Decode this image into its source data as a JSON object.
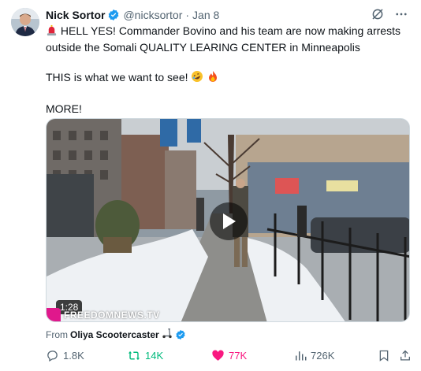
{
  "author": {
    "name": "Nick Sortor",
    "handle": "@nicksortor",
    "separator": "·",
    "date": "Jan 8"
  },
  "tweet": {
    "line1": "HELL YES! Commander Bovino and his team are now making arrests outside the Somali QUALITY LEARING CENTER in Minneapolis",
    "line2": "THIS is what we want to see!",
    "line3": "MORE!"
  },
  "media": {
    "duration": "1:28",
    "watermark": "FREEDOMNEWS.TV"
  },
  "source": {
    "prefix": "From",
    "name": "Oliya Scootercaster"
  },
  "actions": {
    "replies": "1.8K",
    "reposts": "14K",
    "likes": "77K",
    "views": "726K"
  },
  "colors": {
    "verified": "#1d9bf0",
    "repost_active": "#00ba7c",
    "like_active": "#f91880",
    "secondary_text": "#536471"
  }
}
